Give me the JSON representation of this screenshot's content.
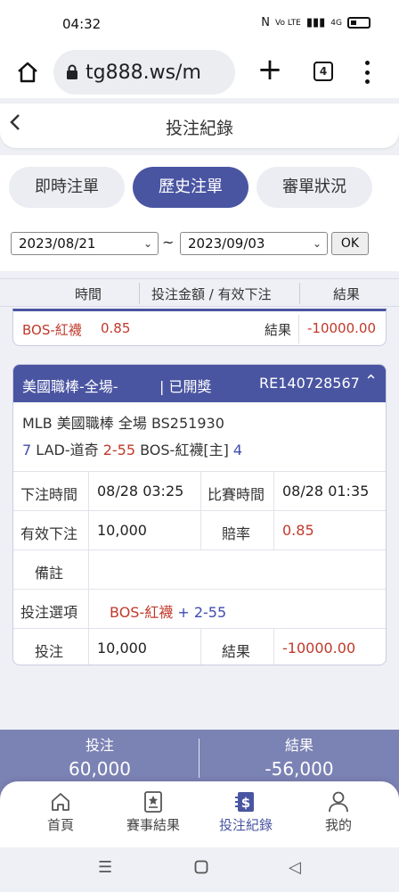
{
  "status_bar": {
    "time": "04:32",
    "signal": "4G",
    "network": "Vo LTE"
  },
  "browser": {
    "url": "tg888.ws/m",
    "tab_count": "4"
  },
  "header": {
    "title": "投注紀錄"
  },
  "tabs": [
    {
      "label": "即時注單",
      "active": false
    },
    {
      "label": "歷史注單",
      "active": true
    },
    {
      "label": "審單狀況",
      "active": false
    }
  ],
  "date_filter": {
    "start": "2023/08/21",
    "end": "2023/09/03",
    "separator": "~",
    "ok_label": "OK"
  },
  "columns": {
    "time": "時間",
    "amount": "投注金額 / 有效下注",
    "result": "結果"
  },
  "prev_bet": {
    "pick": "BOS-紅襪",
    "odds": "0.85",
    "result_label": "結果",
    "result_value": "-10000.00"
  },
  "bet_card": {
    "league": "美國職棒-全場-",
    "status": "| 已開獎",
    "ticket": "RE140728567",
    "match_line": "MLB 美國職棒 全場 BS251930",
    "away_num": "7",
    "away_team": "LAD-道奇",
    "score": "2-55",
    "home_team": "BOS-紅襪[主]",
    "home_num": "4",
    "rows": {
      "bet_time_label": "下注時間",
      "bet_time": "08/28 03:25",
      "match_time_label": "比賽時間",
      "match_time": "08/28 01:35",
      "valid_label": "有效下注",
      "valid_value": "10,000",
      "odds_label": "賠率",
      "odds_value": "0.85",
      "note_label": "備註",
      "note_value": "",
      "option_label": "投注選項",
      "option_team": "BOS-紅襪",
      "option_plus": "+",
      "option_line": "2-55",
      "stake_label": "投注",
      "stake_value": "10,000",
      "result_label": "結果",
      "result_value": "-10000.00"
    }
  },
  "summary": {
    "stake_label": "投注",
    "stake_value": "60,000",
    "result_label": "結果",
    "result_value": "-56,000"
  },
  "bottom_nav": [
    {
      "label": "首頁",
      "icon": "home-icon",
      "active": false
    },
    {
      "label": "賽事結果",
      "icon": "star-doc-icon",
      "active": false
    },
    {
      "label": "投注紀錄",
      "icon": "dollar-doc-icon",
      "active": true
    },
    {
      "label": "我的",
      "icon": "person-icon",
      "active": false
    }
  ],
  "colors": {
    "accent": "#4a55a2",
    "negative": "#c0392b",
    "summary_bg": "#7b82b4"
  }
}
